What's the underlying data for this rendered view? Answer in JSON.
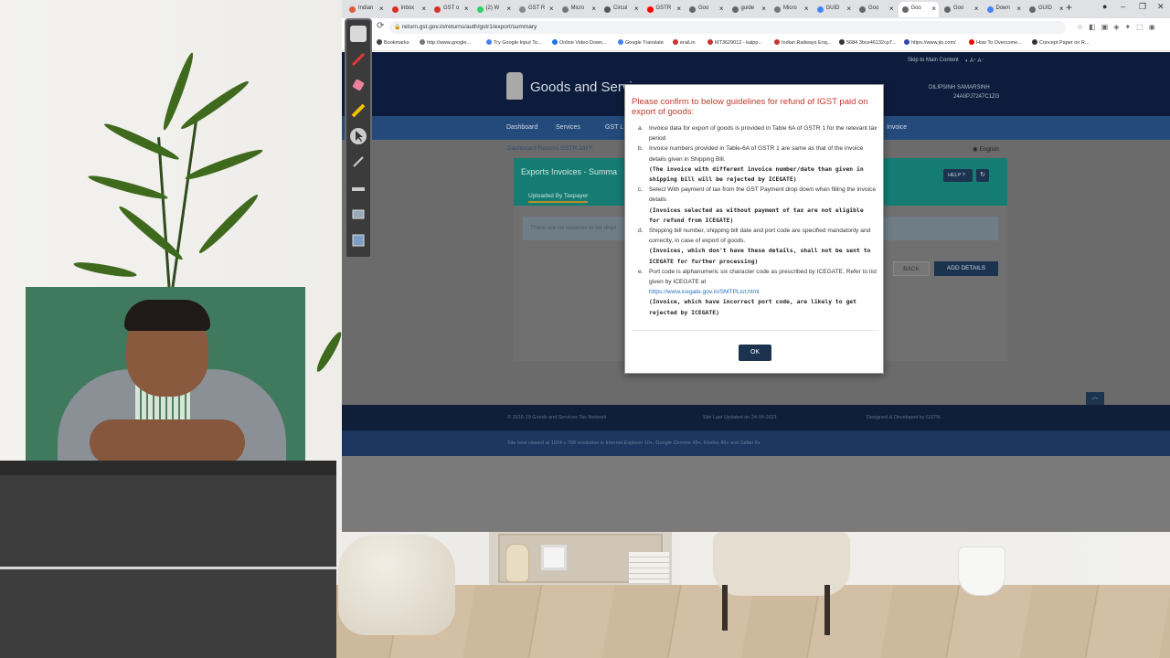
{
  "browser": {
    "tabs": [
      {
        "label": "Indian",
        "color": "#e15a3a"
      },
      {
        "label": "Inbox",
        "color": "#d93025"
      },
      {
        "label": "GST o",
        "color": "#d93025"
      },
      {
        "label": "(2) W",
        "color": "#25d366"
      },
      {
        "label": "GST R",
        "color": "#888888"
      },
      {
        "label": "Micro",
        "color": "#777777"
      },
      {
        "label": "Circul",
        "color": "#555555"
      },
      {
        "label": "GSTR",
        "color": "#ff0000"
      },
      {
        "label": "Goo",
        "color": "#666666"
      },
      {
        "label": "guide",
        "color": "#666666"
      },
      {
        "label": "Micro",
        "color": "#777777"
      },
      {
        "label": "GUID",
        "color": "#4285f4"
      },
      {
        "label": "Goo",
        "color": "#666666"
      },
      {
        "label": "Goo",
        "color": "#666666",
        "active": true
      },
      {
        "label": "Goo",
        "color": "#666666"
      },
      {
        "label": "Down",
        "color": "#4285f4"
      },
      {
        "label": "GUID",
        "color": "#666666"
      }
    ],
    "url": "return.gst.gov.in/returns/auth/gstr1/export/summary",
    "bookmarks": [
      {
        "label": "Bookmarks",
        "color": "#444444"
      },
      {
        "label": "http://www.google...",
        "color": "#777777"
      },
      {
        "label": "Try Google Input To...",
        "color": "#4285f4"
      },
      {
        "label": "Online Video Down...",
        "color": "#1a73e8"
      },
      {
        "label": "Google Translate",
        "color": "#4285f4"
      },
      {
        "label": "eraiLin",
        "color": "#cc3333"
      },
      {
        "label": "MT3629012 - kalpp...",
        "color": "#cc3333"
      },
      {
        "label": "Indian Railways Enq...",
        "color": "#cc3333"
      },
      {
        "label": "5684 3bce46132cp7...",
        "color": "#333333"
      },
      {
        "label": "https://www.jio.com/",
        "color": "#3344aa"
      },
      {
        "label": "How To Overcome...",
        "color": "#ff0000"
      },
      {
        "label": "Concept Paper on R...",
        "color": "#333333"
      }
    ]
  },
  "gst": {
    "skip": "Skip to Main Content",
    "title": "Goods and Servi",
    "user_name": "DILIPSINH SAMARSINH",
    "user_gstin": "24AIIPJ7247C1ZG",
    "nav": [
      "Dashboard",
      "Services",
      "GST L",
      "Invoice"
    ],
    "crumbs": "Dashboard   Returns   GSTR-1/IFF",
    "lang": "English",
    "panel_title": "Exports Invoices - Summa",
    "panel_tab": "Uploaded By Taxpayer",
    "help": "HELP",
    "no_invoices": "There are no invoices to be displ",
    "back": "BACK",
    "add": "ADD DETAILS",
    "footer_copy": "© 2016-19 Goods and Services Tax Network",
    "footer_updated": "Site Last Updated on 24-04-2021",
    "footer_dev": "Designed & Developed by GSTN",
    "footer_browser": "Site best viewed at 1024 x 768 resolution in Internet Explorer 10+, Google Chrome 49+, Firefox 45+ and Safari 6+"
  },
  "modal": {
    "title": "Please confirm to below guidelines for refund of IGST paid on export of goods:",
    "items": [
      {
        "marker": "a.",
        "text": "Invoice data for export of goods is provided in Table 6A of GSTR 1 for the relevant tax period",
        "bold": ""
      },
      {
        "marker": "b.",
        "text": "Invoice numbers provided in Table-6A of GSTR 1 are same as that of the invoice details given in Shipping Bill.",
        "bold": "(The invoice with different invoice number/date than given in shipping bill will be rejected by ICEGATE)"
      },
      {
        "marker": "c.",
        "text": "Select With payment of tax from the GST Payment drop down when filling the invoice details",
        "bold": "(Invoices selected as without payment of tax are not eligible for refund from ICEGATE)"
      },
      {
        "marker": "d.",
        "text": "Shipping bill number, shipping bill date and port code are specified mandatorily and correctly, in case of export of goods.",
        "bold": "(Invoices, which don't have these details, shall not be sent to ICEGATE for further processing)"
      },
      {
        "marker": "e.",
        "text": "Port code is alphanumeric six character code as prescribed by ICEGATE. Refer to list given by ICEGATE at",
        "link": "https://www.icegate.gov.in/SMTPList.html",
        "bold": "(Invoice, which have incorrect port code, are likely to get rejected by ICEGATE)"
      }
    ],
    "ok": "OK"
  }
}
